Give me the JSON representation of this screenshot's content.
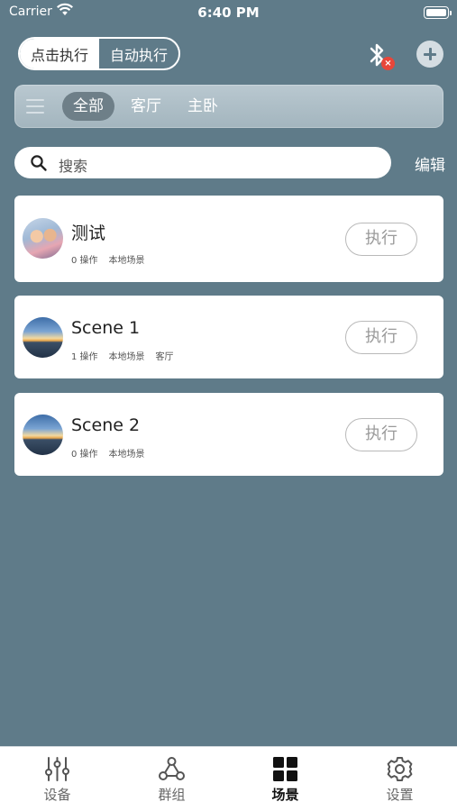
{
  "status_bar": {
    "carrier": "Carrier",
    "time": "6:40 PM"
  },
  "mode_toggle": {
    "options": [
      "点击执行",
      "自动执行"
    ],
    "selected": "点击执行"
  },
  "bluetooth": {
    "status": "disconnected",
    "badge": "×"
  },
  "room_tabs": [
    {
      "label": "全部",
      "active": true
    },
    {
      "label": "客厅",
      "active": false
    },
    {
      "label": "主卧",
      "active": false
    }
  ],
  "search": {
    "placeholder": "搜索"
  },
  "edit_label": "编辑",
  "scenes": [
    {
      "name": "测试",
      "meta": [
        "0 操作",
        "本地场景"
      ],
      "thumbnail": "family-photo",
      "action": "执行"
    },
    {
      "name": "Scene 1",
      "meta": [
        "1 操作",
        "本地场景",
        "客厅"
      ],
      "thumbnail": "sunset-photo",
      "action": "执行"
    },
    {
      "name": "Scene 2",
      "meta": [
        "0 操作",
        "本地场景"
      ],
      "thumbnail": "sunset-photo",
      "action": "执行"
    }
  ],
  "tab_bar": [
    {
      "label": "设备",
      "icon": "sliders-icon",
      "active": false
    },
    {
      "label": "群组",
      "icon": "group-icon",
      "active": false
    },
    {
      "label": "场景",
      "icon": "grid-icon",
      "active": true
    },
    {
      "label": "设置",
      "icon": "gear-icon",
      "active": false
    }
  ],
  "colors": {
    "background": "#5f7b89",
    "card": "#ffffff",
    "badge": "#e8463a"
  }
}
